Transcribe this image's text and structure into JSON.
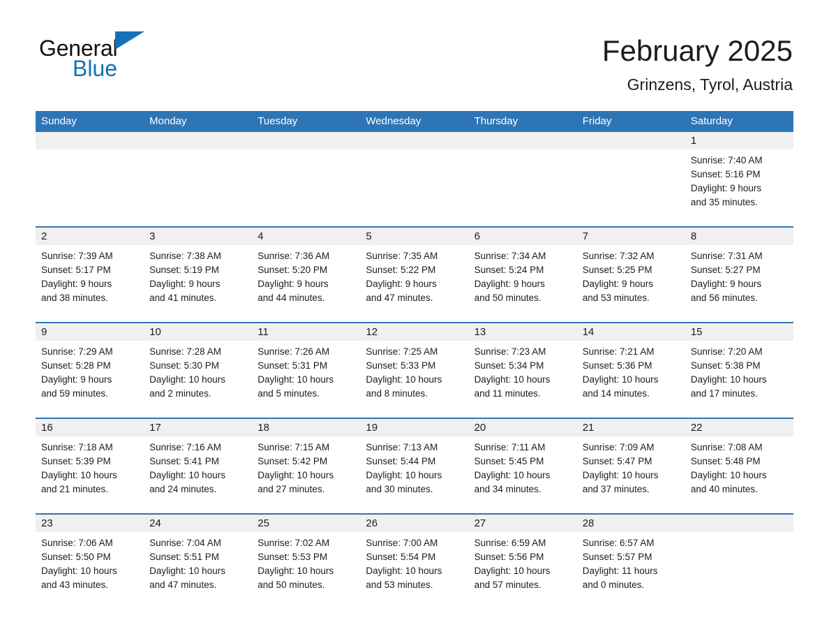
{
  "brand": {
    "name_part1": "General",
    "name_part2": "Blue",
    "logo_icon": "triangle-flag-icon"
  },
  "header": {
    "month_title": "February 2025",
    "location": "Grinzens, Tyrol, Austria"
  },
  "calendar": {
    "weekday_headers": [
      "Sunday",
      "Monday",
      "Tuesday",
      "Wednesday",
      "Thursday",
      "Friday",
      "Saturday"
    ],
    "colors": {
      "header_blue": "#2e75b6",
      "date_strip_gray": "#f0f0f0",
      "brand_blue": "#1272b5",
      "text": "#1c1c1c"
    },
    "weeks": [
      [
        {
          "day": "",
          "blank": true
        },
        {
          "day": "",
          "blank": true
        },
        {
          "day": "",
          "blank": true
        },
        {
          "day": "",
          "blank": true
        },
        {
          "day": "",
          "blank": true
        },
        {
          "day": "",
          "blank": true
        },
        {
          "day": "1",
          "sunrise": "Sunrise: 7:40 AM",
          "sunset": "Sunset: 5:16 PM",
          "daylight_line1": "Daylight: 9 hours",
          "daylight_line2": "and 35 minutes."
        }
      ],
      [
        {
          "day": "2",
          "sunrise": "Sunrise: 7:39 AM",
          "sunset": "Sunset: 5:17 PM",
          "daylight_line1": "Daylight: 9 hours",
          "daylight_line2": "and 38 minutes."
        },
        {
          "day": "3",
          "sunrise": "Sunrise: 7:38 AM",
          "sunset": "Sunset: 5:19 PM",
          "daylight_line1": "Daylight: 9 hours",
          "daylight_line2": "and 41 minutes."
        },
        {
          "day": "4",
          "sunrise": "Sunrise: 7:36 AM",
          "sunset": "Sunset: 5:20 PM",
          "daylight_line1": "Daylight: 9 hours",
          "daylight_line2": "and 44 minutes."
        },
        {
          "day": "5",
          "sunrise": "Sunrise: 7:35 AM",
          "sunset": "Sunset: 5:22 PM",
          "daylight_line1": "Daylight: 9 hours",
          "daylight_line2": "and 47 minutes."
        },
        {
          "day": "6",
          "sunrise": "Sunrise: 7:34 AM",
          "sunset": "Sunset: 5:24 PM",
          "daylight_line1": "Daylight: 9 hours",
          "daylight_line2": "and 50 minutes."
        },
        {
          "day": "7",
          "sunrise": "Sunrise: 7:32 AM",
          "sunset": "Sunset: 5:25 PM",
          "daylight_line1": "Daylight: 9 hours",
          "daylight_line2": "and 53 minutes."
        },
        {
          "day": "8",
          "sunrise": "Sunrise: 7:31 AM",
          "sunset": "Sunset: 5:27 PM",
          "daylight_line1": "Daylight: 9 hours",
          "daylight_line2": "and 56 minutes."
        }
      ],
      [
        {
          "day": "9",
          "sunrise": "Sunrise: 7:29 AM",
          "sunset": "Sunset: 5:28 PM",
          "daylight_line1": "Daylight: 9 hours",
          "daylight_line2": "and 59 minutes."
        },
        {
          "day": "10",
          "sunrise": "Sunrise: 7:28 AM",
          "sunset": "Sunset: 5:30 PM",
          "daylight_line1": "Daylight: 10 hours",
          "daylight_line2": "and 2 minutes."
        },
        {
          "day": "11",
          "sunrise": "Sunrise: 7:26 AM",
          "sunset": "Sunset: 5:31 PM",
          "daylight_line1": "Daylight: 10 hours",
          "daylight_line2": "and 5 minutes."
        },
        {
          "day": "12",
          "sunrise": "Sunrise: 7:25 AM",
          "sunset": "Sunset: 5:33 PM",
          "daylight_line1": "Daylight: 10 hours",
          "daylight_line2": "and 8 minutes."
        },
        {
          "day": "13",
          "sunrise": "Sunrise: 7:23 AM",
          "sunset": "Sunset: 5:34 PM",
          "daylight_line1": "Daylight: 10 hours",
          "daylight_line2": "and 11 minutes."
        },
        {
          "day": "14",
          "sunrise": "Sunrise: 7:21 AM",
          "sunset": "Sunset: 5:36 PM",
          "daylight_line1": "Daylight: 10 hours",
          "daylight_line2": "and 14 minutes."
        },
        {
          "day": "15",
          "sunrise": "Sunrise: 7:20 AM",
          "sunset": "Sunset: 5:38 PM",
          "daylight_line1": "Daylight: 10 hours",
          "daylight_line2": "and 17 minutes."
        }
      ],
      [
        {
          "day": "16",
          "sunrise": "Sunrise: 7:18 AM",
          "sunset": "Sunset: 5:39 PM",
          "daylight_line1": "Daylight: 10 hours",
          "daylight_line2": "and 21 minutes."
        },
        {
          "day": "17",
          "sunrise": "Sunrise: 7:16 AM",
          "sunset": "Sunset: 5:41 PM",
          "daylight_line1": "Daylight: 10 hours",
          "daylight_line2": "and 24 minutes."
        },
        {
          "day": "18",
          "sunrise": "Sunrise: 7:15 AM",
          "sunset": "Sunset: 5:42 PM",
          "daylight_line1": "Daylight: 10 hours",
          "daylight_line2": "and 27 minutes."
        },
        {
          "day": "19",
          "sunrise": "Sunrise: 7:13 AM",
          "sunset": "Sunset: 5:44 PM",
          "daylight_line1": "Daylight: 10 hours",
          "daylight_line2": "and 30 minutes."
        },
        {
          "day": "20",
          "sunrise": "Sunrise: 7:11 AM",
          "sunset": "Sunset: 5:45 PM",
          "daylight_line1": "Daylight: 10 hours",
          "daylight_line2": "and 34 minutes."
        },
        {
          "day": "21",
          "sunrise": "Sunrise: 7:09 AM",
          "sunset": "Sunset: 5:47 PM",
          "daylight_line1": "Daylight: 10 hours",
          "daylight_line2": "and 37 minutes."
        },
        {
          "day": "22",
          "sunrise": "Sunrise: 7:08 AM",
          "sunset": "Sunset: 5:48 PM",
          "daylight_line1": "Daylight: 10 hours",
          "daylight_line2": "and 40 minutes."
        }
      ],
      [
        {
          "day": "23",
          "sunrise": "Sunrise: 7:06 AM",
          "sunset": "Sunset: 5:50 PM",
          "daylight_line1": "Daylight: 10 hours",
          "daylight_line2": "and 43 minutes."
        },
        {
          "day": "24",
          "sunrise": "Sunrise: 7:04 AM",
          "sunset": "Sunset: 5:51 PM",
          "daylight_line1": "Daylight: 10 hours",
          "daylight_line2": "and 47 minutes."
        },
        {
          "day": "25",
          "sunrise": "Sunrise: 7:02 AM",
          "sunset": "Sunset: 5:53 PM",
          "daylight_line1": "Daylight: 10 hours",
          "daylight_line2": "and 50 minutes."
        },
        {
          "day": "26",
          "sunrise": "Sunrise: 7:00 AM",
          "sunset": "Sunset: 5:54 PM",
          "daylight_line1": "Daylight: 10 hours",
          "daylight_line2": "and 53 minutes."
        },
        {
          "day": "27",
          "sunrise": "Sunrise: 6:59 AM",
          "sunset": "Sunset: 5:56 PM",
          "daylight_line1": "Daylight: 10 hours",
          "daylight_line2": "and 57 minutes."
        },
        {
          "day": "28",
          "sunrise": "Sunrise: 6:57 AM",
          "sunset": "Sunset: 5:57 PM",
          "daylight_line1": "Daylight: 11 hours",
          "daylight_line2": "and 0 minutes."
        },
        {
          "day": "",
          "blank": true
        }
      ]
    ]
  }
}
